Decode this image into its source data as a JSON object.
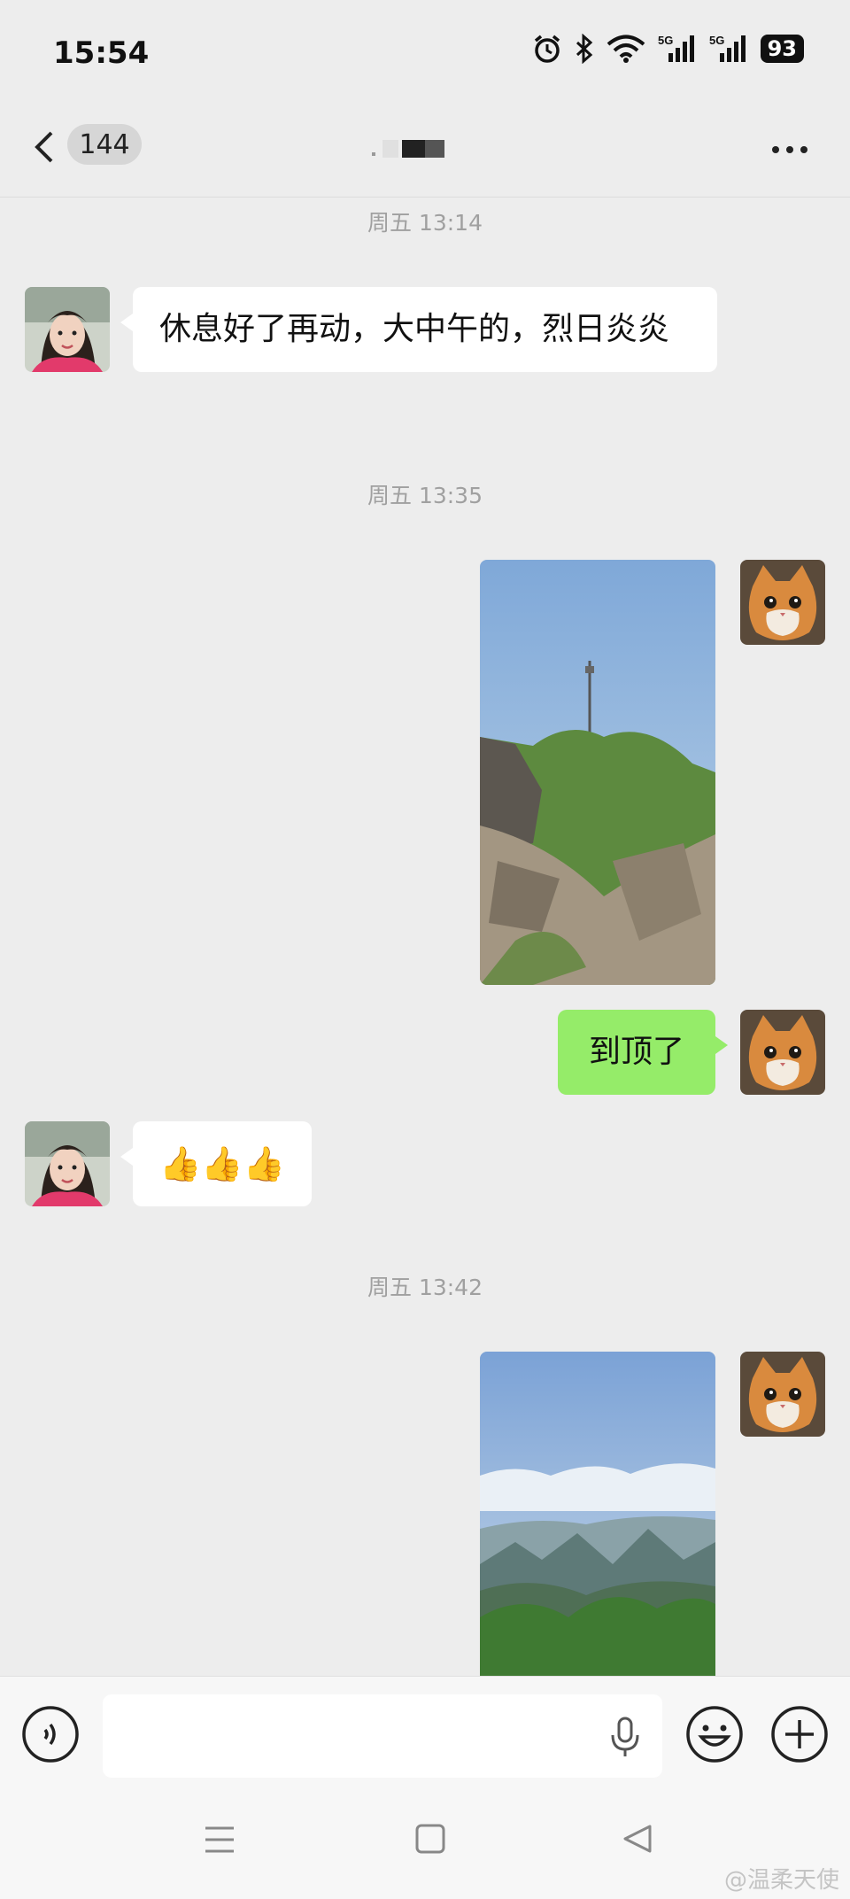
{
  "status_bar": {
    "time": "15:54",
    "battery": "93",
    "icons": [
      "alarm-icon",
      "bluetooth-icon",
      "wifi-icon",
      "5g-signal-icon",
      "5g-signal-icon",
      "battery-icon"
    ]
  },
  "header": {
    "unread_count": "144",
    "more_icon": "more-dots-icon"
  },
  "messages": [
    {
      "type": "timestamp",
      "text": "周五 13:14"
    },
    {
      "type": "text",
      "side": "left",
      "text": "休息好了再动，大中午的，烈日炎炎"
    },
    {
      "type": "timestamp",
      "text": "周五 13:35"
    },
    {
      "type": "image",
      "side": "right",
      "description": "mountain-tower-photo"
    },
    {
      "type": "text",
      "side": "right",
      "text": "到顶了"
    },
    {
      "type": "emoji",
      "side": "left",
      "text": "👍👍👍"
    },
    {
      "type": "timestamp",
      "text": "周五 13:42"
    },
    {
      "type": "image",
      "side": "right",
      "description": "mountain-view-photo"
    }
  ],
  "input_bar": {
    "placeholder": "",
    "voice_icon": "voice-mode-icon",
    "mic_icon": "microphone-icon",
    "emoji_icon": "emoji-icon",
    "plus_icon": "plus-icon"
  },
  "nav_bar": {
    "watermark": "@温柔天使"
  },
  "colors": {
    "background": "#ededed",
    "outgoing_bubble": "#95ec69",
    "incoming_bubble": "#ffffff"
  }
}
